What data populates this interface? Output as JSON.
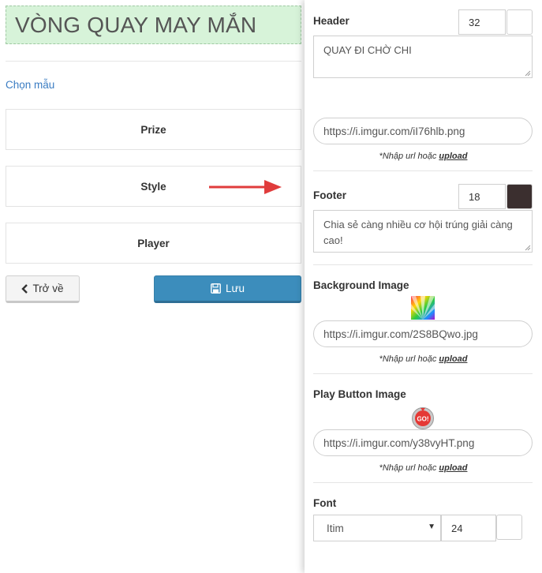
{
  "left": {
    "title": "VÒNG QUAY MAY MẮN",
    "choose_template": "Chọn mẫu",
    "menu": [
      {
        "label": "Prize"
      },
      {
        "label": "Style"
      },
      {
        "label": "Player"
      }
    ],
    "back_label": "Trở về",
    "save_label": "Lưu"
  },
  "panel": {
    "header": {
      "label": "Header",
      "font_size": "32",
      "color": "#ffffff",
      "text": "QUAY ĐI CHỜ CHI",
      "image_url": "https://i.imgur.com/iI76hlb.png"
    },
    "hint_text": "*Nhập url hoặc ",
    "hint_link": "upload",
    "footer": {
      "label": "Footer",
      "font_size": "18",
      "color": "#3b2f2f",
      "text": "Chia sẻ càng nhiều cơ hội trúng giải càng cao!"
    },
    "background_image": {
      "label": "Background Image",
      "url": "https://i.imgur.com/2S8BQwo.jpg"
    },
    "play_button_image": {
      "label": "Play Button Image",
      "url": "https://i.imgur.com/y38vyHT.png",
      "badge_text": "GO!"
    },
    "font": {
      "label": "Font",
      "family": "Itim",
      "size": "24",
      "color": "#ffffff"
    }
  },
  "colors": {
    "title_bg": "#d7f3d9",
    "link": "#3a7cc2",
    "save_button": "#3c8dbc",
    "arrow": "#e03c3c"
  }
}
